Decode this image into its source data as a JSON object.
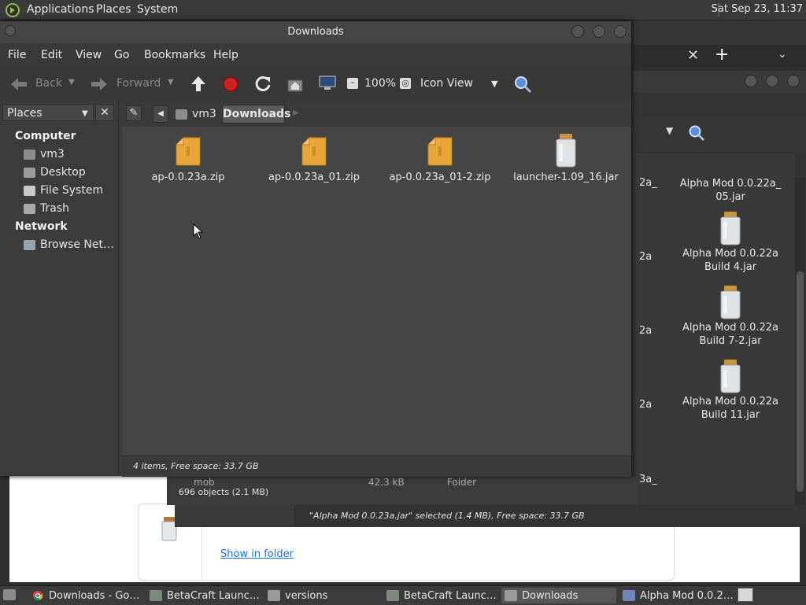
{
  "top_panel": {
    "menus": [
      "Applications",
      "Places",
      "System"
    ],
    "clock": "Sat Sep 23, 11:37"
  },
  "browser": {
    "show_in_folder": "Show in folder"
  },
  "bg_window": {
    "files": [
      {
        "name": "Alpha Mod 0.0.22a_ 05.jar",
        "line1": "Alpha Mod 0.0.22a_",
        "line2": "05.jar"
      },
      {
        "name": "Alpha Mod 0.0.22a Build 4.jar",
        "line1": "Alpha Mod 0.0.22a",
        "line2": "Build 4.jar"
      },
      {
        "name": "Alpha Mod 0.0.22a Build 7-2.jar",
        "line1": "Alpha Mod 0.0.22a",
        "line2": "Build 7-2.jar"
      },
      {
        "name": "Alpha Mod 0.0.22a Build 11.jar",
        "line1": "Alpha Mod 0.0.22a",
        "line2": "Build 11.jar"
      }
    ],
    "partial_labels": [
      "2a_",
      "2a",
      "2a",
      "2a",
      "3a_"
    ],
    "list_partial": {
      "name": "mob",
      "size": "42.3 kB",
      "type": "Folder"
    },
    "objects_status": "696 objects (2.1 MB)",
    "selected_status": "\"Alpha Mod 0.0.23a.jar\" selected (1.4 MB), Free space: 33.7 GB"
  },
  "window": {
    "title": "Downloads",
    "menus": [
      "File",
      "Edit",
      "View",
      "Go",
      "Bookmarks",
      "Help"
    ],
    "toolbar": {
      "back": "Back",
      "forward": "Forward",
      "zoom": "100%",
      "view_mode": "Icon View"
    },
    "sidebar": {
      "header": "Places",
      "computer_label": "Computer",
      "computer_items": [
        "vm3",
        "Desktop",
        "File System",
        "Trash"
      ],
      "network_label": "Network",
      "network_items": [
        "Browse Net…"
      ]
    },
    "path": [
      "vm3",
      "Downloads"
    ],
    "files": [
      {
        "name": "ap-0.0.23a.zip",
        "kind": "zip"
      },
      {
        "name": "ap-0.0.23a_01.zip",
        "kind": "zip"
      },
      {
        "name": "ap-0.0.23a_01-2.zip",
        "kind": "zip"
      },
      {
        "name": "launcher-1.09_16.jar",
        "kind": "jar"
      }
    ],
    "status": "4 items, Free space: 33.7 GB"
  },
  "taskbar": {
    "tasks": [
      {
        "label": "Downloads - Go…",
        "icon": "chrome-icon"
      },
      {
        "label": "BetaCraft Launc…",
        "icon": "java-icon"
      },
      {
        "label": "versions",
        "icon": "folder-icon"
      },
      {
        "label": "BetaCraft Launc…",
        "icon": "java-icon"
      },
      {
        "label": "Downloads",
        "icon": "folder-icon"
      },
      {
        "label": "Alpha Mod 0.0.2…",
        "icon": "archive-icon"
      }
    ]
  },
  "colors": {
    "accent": "#1a73e8",
    "folder": "#e8a738",
    "stop": "#cc2222"
  }
}
